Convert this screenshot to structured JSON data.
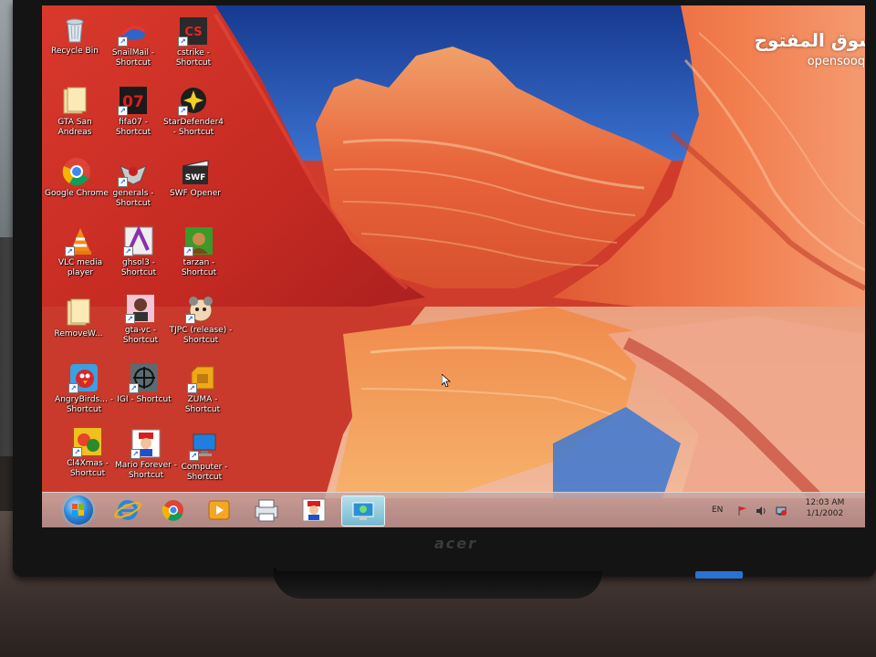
{
  "desktop": {
    "icons": [
      {
        "label": "Recycle Bin",
        "icon": "recycle-bin-icon",
        "shortcut": false
      },
      {
        "label": "SnailMail - Shortcut",
        "icon": "snailmail-icon",
        "shortcut": true
      },
      {
        "label": "cstrike - Shortcut",
        "icon": "counter-strike-icon",
        "shortcut": true
      },
      {
        "label": "GTA San Andreas",
        "icon": "folder-icon",
        "shortcut": false
      },
      {
        "label": "fifa07 - Shortcut",
        "icon": "fifa07-icon",
        "shortcut": true
      },
      {
        "label": "StarDefender4 - Shortcut",
        "icon": "stardefender-icon",
        "shortcut": true
      },
      {
        "label": "Google Chrome",
        "icon": "chrome-icon",
        "shortcut": false
      },
      {
        "label": "generals - Shortcut",
        "icon": "generals-icon",
        "shortcut": true
      },
      {
        "label": "SWF Opener",
        "icon": "swf-opener-icon",
        "shortcut": false
      },
      {
        "label": "VLC media player",
        "icon": "vlc-icon",
        "shortcut": false
      },
      {
        "label": "ghsol3 - Shortcut",
        "icon": "ghsol3-icon",
        "shortcut": true
      },
      {
        "label": "tarzan - Shortcut",
        "icon": "tarzan-icon",
        "shortcut": true
      },
      {
        "label": "RemoveW...",
        "icon": "folder-icon",
        "shortcut": false
      },
      {
        "label": "gta-vc - Shortcut",
        "icon": "gta-vc-icon",
        "shortcut": true
      },
      {
        "label": "TJPC (release) - Shortcut",
        "icon": "tjpc-icon",
        "shortcut": true
      },
      {
        "label": "AngryBirds... - Shortcut",
        "icon": "angry-birds-icon",
        "shortcut": true
      },
      {
        "label": "IGI - Shortcut",
        "icon": "igi-icon",
        "shortcut": true
      },
      {
        "label": "ZUMA - Shortcut",
        "icon": "zuma-icon",
        "shortcut": true
      },
      {
        "label": "Cl4Xmas - Shortcut",
        "icon": "cl4xmas-icon",
        "shortcut": true
      },
      {
        "label": "Mario Forever - Shortcut",
        "icon": "mario-forever-icon",
        "shortcut": true
      },
      {
        "label": "Computer - Shortcut",
        "icon": "computer-icon",
        "shortcut": true
      }
    ]
  },
  "taskbar": {
    "pinned": [
      {
        "name": "Internet Explorer",
        "icon": "internet-explorer-icon"
      },
      {
        "name": "Google Chrome",
        "icon": "chrome-icon"
      },
      {
        "name": "Windows Media Player",
        "icon": "media-player-icon"
      },
      {
        "name": "Printer",
        "icon": "printer-icon"
      },
      {
        "name": "Mario Forever",
        "icon": "mario-forever-icon"
      },
      {
        "name": "Remote Desktop",
        "icon": "remote-desktop-icon",
        "active": true
      }
    ],
    "tray": {
      "language": "EN",
      "time": "12:03 AM",
      "date": "1/1/2002"
    }
  },
  "watermark": {
    "arabic": "السوق المفتوح",
    "latin": "opensooq.com"
  },
  "monitor": {
    "brand": "acer"
  },
  "colors": {
    "sky": "#1f4fb0",
    "rock_orange": "#e8643a",
    "rock_red": "#c7322a",
    "taskbar_active": "#8fd3e8"
  }
}
